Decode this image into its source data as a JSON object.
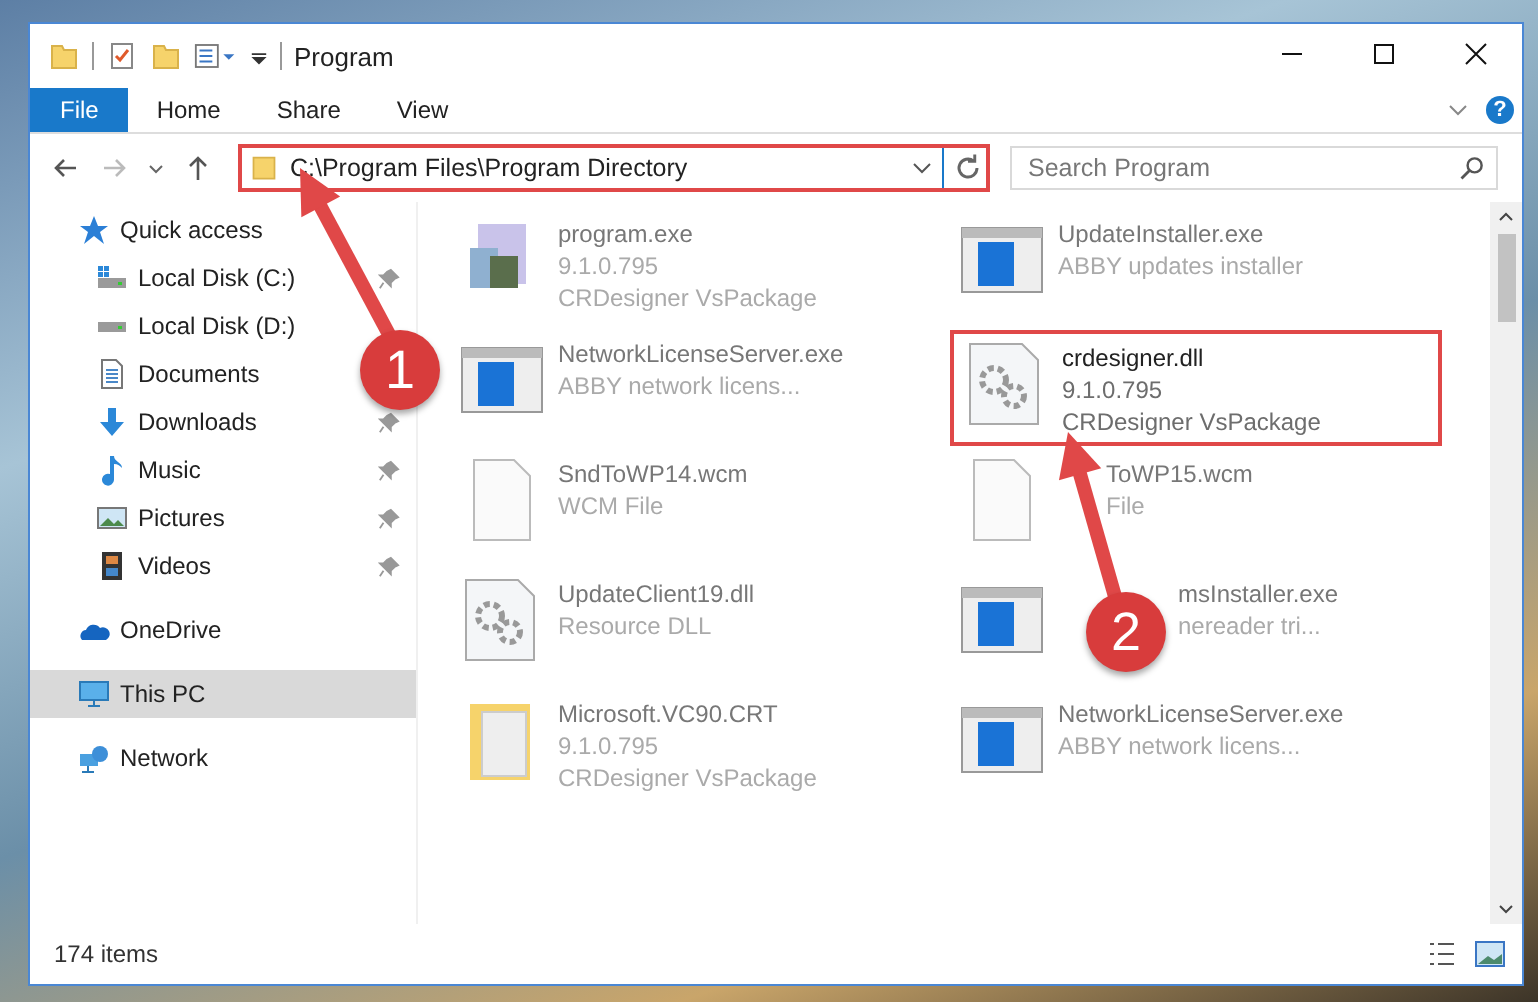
{
  "window": {
    "title": "Program"
  },
  "ribbon": {
    "tabs": [
      {
        "label": "File",
        "selected": true
      },
      {
        "label": "Home",
        "selected": false
      },
      {
        "label": "Share",
        "selected": false
      },
      {
        "label": "View",
        "selected": false
      }
    ],
    "help": "?"
  },
  "address_bar": {
    "path": "C:\\Program Files\\Program Directory",
    "highlighted": true
  },
  "search": {
    "placeholder": "Search Program"
  },
  "sidebar": {
    "items": [
      {
        "label": "Quick access",
        "selected": false,
        "children": [
          {
            "label": "Local Disk (C:)",
            "pinned": true
          },
          {
            "label": "Local Disk (D:)",
            "pinned": false
          },
          {
            "label": "Documents",
            "pinned": false
          },
          {
            "label": "Downloads",
            "pinned": true
          },
          {
            "label": "Music",
            "pinned": true
          },
          {
            "label": "Pictures",
            "pinned": true
          },
          {
            "label": "Videos",
            "pinned": true
          }
        ]
      },
      {
        "label": "OneDrive",
        "selected": false
      },
      {
        "label": "This PC",
        "selected": true
      },
      {
        "label": "Network",
        "selected": false
      }
    ]
  },
  "files": [
    {
      "name": "program.exe",
      "details": [
        "9.1.0.795",
        "CRDesigner VsPackage"
      ],
      "highlighted": false
    },
    {
      "name": "UpdateInstaller.exe",
      "details": [
        "ABBY updates installer"
      ],
      "highlighted": false
    },
    {
      "name": "NetworkLicenseServer.exe",
      "details": [
        "ABBY network licens..."
      ],
      "highlighted": false
    },
    {
      "name": "crdesigner.dll",
      "details": [
        "9.1.0.795",
        "CRDesigner VsPackage"
      ],
      "highlighted": true
    },
    {
      "name": "SndToWP14.wcm",
      "details": [
        "WCM File"
      ],
      "highlighted": false
    },
    {
      "name": "ToWP15.wcm",
      "details": [
        "File"
      ],
      "highlighted": false
    },
    {
      "name": "UpdateClient19.dll",
      "details": [
        "Resource DLL"
      ],
      "highlighted": false
    },
    {
      "name": "msInstaller.exe",
      "details": [
        "nereader tri..."
      ],
      "highlighted": false
    },
    {
      "name": "Microsoft.VC90.CRT",
      "details": [
        "9.1.0.795",
        "CRDesigner VsPackage"
      ],
      "highlighted": false
    },
    {
      "name": "NetworkLicenseServer.exe",
      "details": [
        "ABBY network licens..."
      ],
      "highlighted": false
    }
  ],
  "status_bar": {
    "count": "174 items"
  },
  "callouts": [
    {
      "number": "1"
    },
    {
      "number": "2"
    }
  ]
}
